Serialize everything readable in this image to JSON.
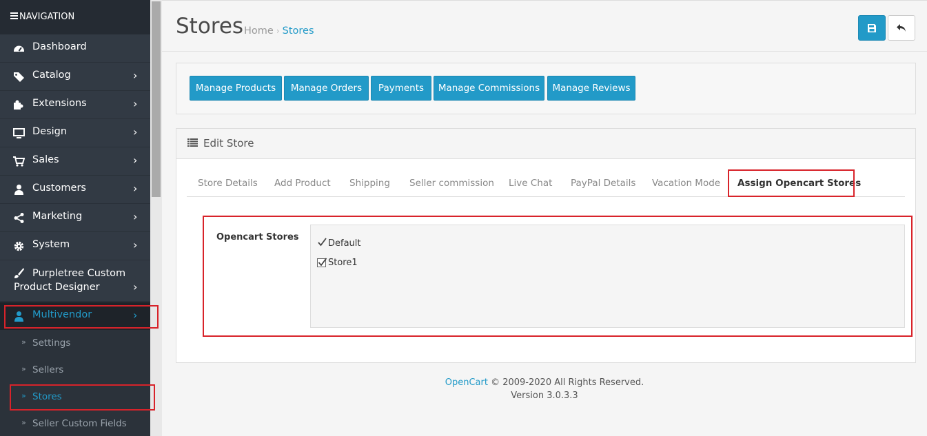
{
  "sidebar": {
    "header": "NAVIGATION",
    "items": [
      {
        "label": "Dashboard",
        "icon": "dashboard-icon"
      },
      {
        "label": "Catalog",
        "icon": "tags-icon"
      },
      {
        "label": "Extensions",
        "icon": "puzzle-icon"
      },
      {
        "label": "Design",
        "icon": "monitor-icon"
      },
      {
        "label": "Sales",
        "icon": "cart-icon"
      },
      {
        "label": "Customers",
        "icon": "user-icon"
      },
      {
        "label": "Marketing",
        "icon": "share-icon"
      },
      {
        "label": "System",
        "icon": "gear-icon"
      },
      {
        "label": "Purpletree Custom Product Designer",
        "icon": "brush-icon"
      },
      {
        "label": "Multivendor",
        "icon": "user-icon"
      }
    ],
    "subitems": [
      {
        "label": "Settings"
      },
      {
        "label": "Sellers"
      },
      {
        "label": "Stores"
      },
      {
        "label": "Seller Custom Fields"
      }
    ]
  },
  "header": {
    "title": "Stores",
    "breadcrumb": [
      "Home",
      "Stores"
    ]
  },
  "manage_buttons": [
    "Manage Products",
    "Manage Orders",
    "Payments",
    "Manage Commissions",
    "Manage Reviews"
  ],
  "edit": {
    "title": "Edit Store",
    "tabs": [
      "Store Details",
      "Add Product",
      "Shipping",
      "Seller commission",
      "Live Chat",
      "PayPal Details",
      "Vacation Mode",
      "Assign Opencart Stores"
    ],
    "stores_label": "Opencart Stores",
    "stores": [
      {
        "name": "Default",
        "checked": true
      },
      {
        "name": "Store1",
        "checked": true
      }
    ]
  },
  "footer": {
    "brand": "OpenCart",
    "copyright": "© 2009-2020 All Rights Reserved.",
    "version": "Version 3.0.3.3"
  },
  "colors": {
    "accent": "#229ac8",
    "highlight": "#d8232a",
    "sidebar": "#323a44"
  }
}
